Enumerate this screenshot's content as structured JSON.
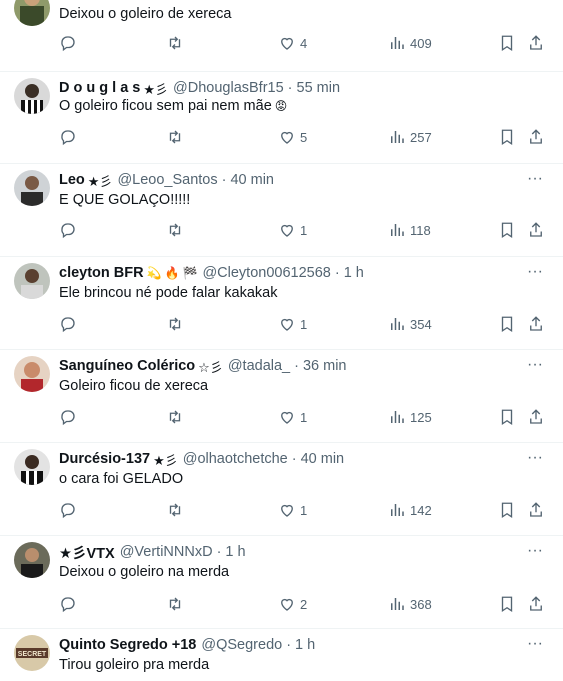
{
  "tweets": [
    {
      "name": "",
      "badge": "",
      "handle": "",
      "time": "",
      "text": "Deixou o goleiro de xereca",
      "likes": "4",
      "views": "409"
    },
    {
      "name": "D o u g l a s",
      "badge": "★彡",
      "handle": "@DhouglasBfr15",
      "time": "55 min",
      "text": "O goleiro ficou sem pai nem mãe",
      "likes": "5",
      "views": "257"
    },
    {
      "name": "Leo",
      "badge": "★彡",
      "handle": "@Leoo_Santos",
      "time": "40 min",
      "text": "E QUE GOLAÇO!!!!!",
      "likes": "1",
      "views": "118"
    },
    {
      "name": "cleyton BFR",
      "badge": "",
      "handle": "@Cleyton00612568",
      "time": "1 h",
      "text": "Ele brincou né pode falar kakakak",
      "likes": "1",
      "views": "354"
    },
    {
      "name": "Sanguíneo Colérico",
      "badge": "☆彡",
      "handle": "@tadala_",
      "time": "36 min",
      "text": "Goleiro ficou de xereca",
      "likes": "1",
      "views": "125"
    },
    {
      "name": "Durcésio-137",
      "badge": "★彡",
      "handle": "@olhaotchetche",
      "time": "40 min",
      "text": "o cara foi GELADO",
      "likes": "1",
      "views": "142"
    },
    {
      "name": "★彡VTX",
      "badge": "",
      "handle": "@VertiNNNxD",
      "time": "1 h",
      "text": "Deixou o goleiro na merda",
      "likes": "2",
      "views": "368"
    },
    {
      "name": "Quinto Segredo +18",
      "badge": "",
      "handle": "@QSegredo",
      "time": "1 h",
      "text": "Tirou goleiro pra merda",
      "likes": "",
      "views": ""
    }
  ],
  "separator": "·",
  "more_label": "···",
  "icons": {
    "reply": "reply-icon",
    "retweet": "retweet-icon",
    "like": "heart-icon",
    "views": "views-icon",
    "bookmark": "bookmark-icon",
    "share": "share-icon"
  },
  "colors": {
    "text": "#0f1419",
    "muted": "#536471",
    "border": "#eff3f4"
  }
}
